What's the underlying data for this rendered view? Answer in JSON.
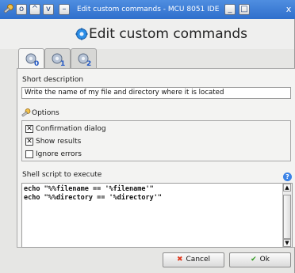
{
  "window": {
    "title": "Edit custom commands - MCU 8051 IDE v",
    "titlebar_buttons": {
      "menu": "o",
      "shade_up": "^",
      "shade_down": "v",
      "minimize": "–",
      "minimize2": "_",
      "maximize": "□",
      "close": "x"
    }
  },
  "header": {
    "title": "Edit custom commands"
  },
  "tabs": [
    {
      "label": "0",
      "active": true
    },
    {
      "label": "1",
      "active": false
    },
    {
      "label": "2",
      "active": false
    }
  ],
  "form": {
    "short_description_label": "Short description",
    "short_description_value": "Write the name of my file and directory where it is located",
    "options_label": "Options",
    "options": [
      {
        "label": "Confirmation dialog",
        "checked": true
      },
      {
        "label": "Show results",
        "checked": true
      },
      {
        "label": "Ignore errors",
        "checked": false
      }
    ],
    "script_label": "Shell script to execute",
    "script_lines": [
      "echo \"%%filename == '%filename'\"",
      "echo \"%%directory == '%directory'\""
    ]
  },
  "buttons": {
    "cancel": "Cancel",
    "ok": "Ok"
  },
  "colors": {
    "titlebar": "#2f6fcc",
    "cancel_icon": "#e03a1f",
    "ok_icon": "#2e9a1c",
    "help": "#3b82e6"
  }
}
